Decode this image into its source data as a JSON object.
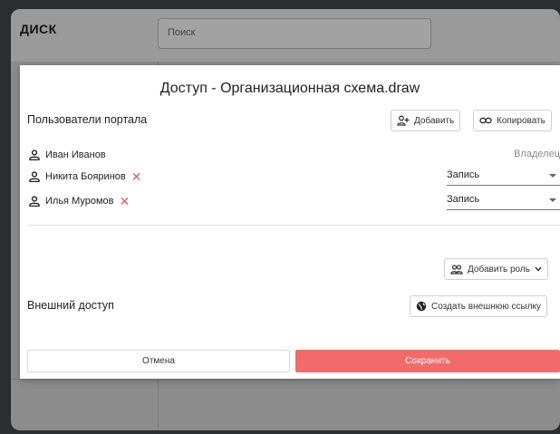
{
  "background": {
    "logo": "ДИСК",
    "search_placeholder": "Поиск"
  },
  "dialog": {
    "title": "Доступ - Организационная схема.draw",
    "portal_users_label": "Пользователи портала",
    "add_button": "Добавить",
    "copy_button": "Копировать",
    "users": [
      {
        "name": "Иван Иванов",
        "role": "Владелец"
      },
      {
        "name": "Никита Бояринов",
        "role": "Запись"
      },
      {
        "name": "Илья Муромов",
        "role": "Запись"
      }
    ],
    "add_role_button": "Добавить роль",
    "external_access_label": "Внешний доступ",
    "create_link_button": "Создать внешнюю ссылку",
    "cancel_button": "Отмена",
    "save_button": "Сохранить"
  },
  "colors": {
    "accent": "#f26b6b",
    "remove": "#e85a5a"
  }
}
